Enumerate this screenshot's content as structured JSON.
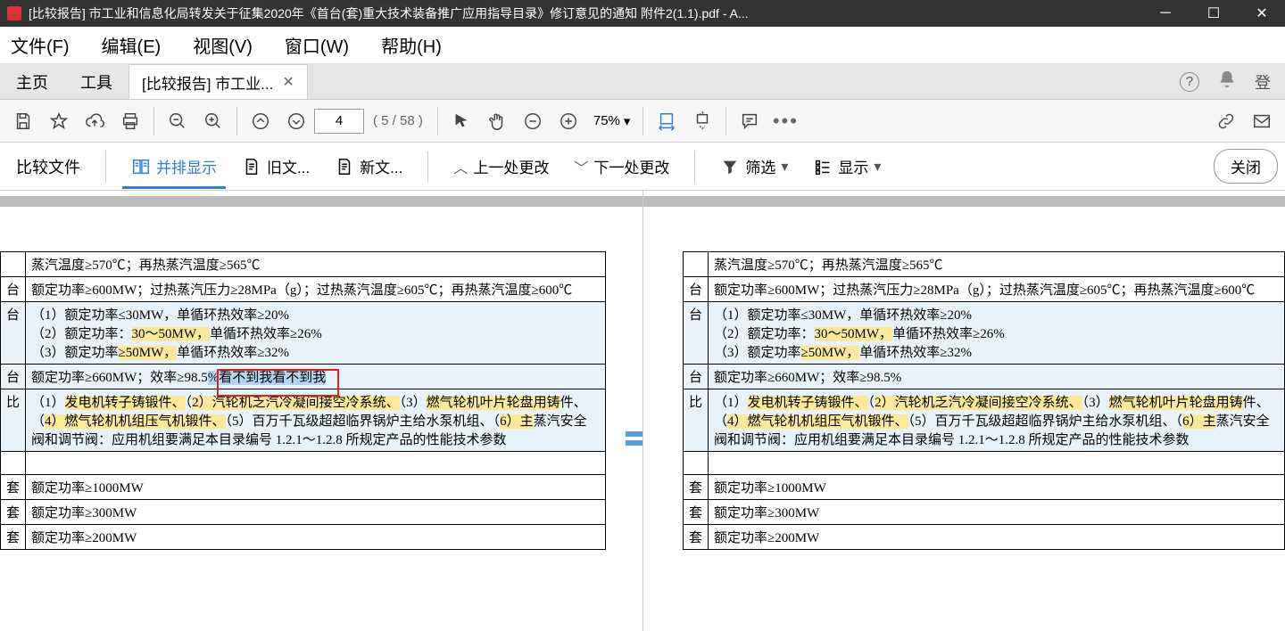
{
  "titlebar": {
    "title": "[比较报告] 市工业和信息化局转发关于征集2020年《首台(套)重大技术装备推广应用指导目录》修订意见的通知 附件2(1.1).pdf - A..."
  },
  "menu": {
    "file": "文件(F)",
    "edit": "编辑(E)",
    "view": "视图(V)",
    "window": "窗口(W)",
    "help": "帮助(H)"
  },
  "tabs": {
    "home": "主页",
    "tools": "工具",
    "active": "[比较报告] 市工业...",
    "login": "登"
  },
  "toolbar": {
    "page_input": "4",
    "page_count": "( 5 / 58 )",
    "zoom": "75%"
  },
  "comparebar": {
    "compare_files": "比较文件",
    "side_by_side": "并排显示",
    "old_doc": "旧文...",
    "new_doc": "新文...",
    "prev_change": "上一处更改",
    "next_change": "下一处更改",
    "filter": "筛选",
    "display": "显示",
    "close": "关闭"
  },
  "doc_left": {
    "rows": [
      {
        "a": "",
        "b": "蒸汽温度≥570℃；再热蒸汽温度≥565℃",
        "cls": ""
      },
      {
        "a": "台",
        "b": "额定功率≥600MW；过热蒸汽压力≥28MPa（g）；过热蒸汽温度≥605℃；再热蒸汽温度≥600℃",
        "cls": ""
      },
      {
        "a": "台",
        "b_html": "（1）额定功率≤30MW，单循环热效率≥20%<br>（2）额定功率：<span class='hl-yellow'>30～50MW，</span>单循环热效率≥26%<br>（3）额定功率<span class='hl-yellow'>≥50MW，</span>单循环热效率≥32%",
        "cls": "row-highlight"
      },
      {
        "a": "台",
        "b_html": "额定功率≥660MW；效率≥98.5<span class='hl-blue'>%看不到我看不到我</span>",
        "cls": "row-highlight",
        "redbox": true
      },
      {
        "a": "比",
        "b_html": "（1）<span class='hl-yellow'>发电机转子铸锻件、</span>（<span class='hl-yellow'>2）汽轮机乏汽冷凝间接空冷系统、</span>（3）<span class='hl-yellow'>燃气轮机叶片轮盘用铸</span>件、（<span class='hl-yellow'>4）燃气轮机机组压气机锻件、</span>（5）百万千瓦级超超临界锅炉主给水泵机组、（<span class='hl-yellow'>6）主</span>蒸汽安全阀和调节阀：应用机组要满足本目录编号 1.2.1～1.2.8 所规定产品的性能技术参数",
        "cls": "row-highlight"
      },
      {
        "a": "",
        "b": "",
        "cls": "nob"
      },
      {
        "a": "套",
        "b": "额定功率≥1000MW",
        "cls": ""
      },
      {
        "a": "套",
        "b": "额定功率≥300MW",
        "cls": ""
      },
      {
        "a": "套",
        "b": "额定功率≥200MW",
        "cls": ""
      }
    ]
  },
  "doc_right": {
    "rows": [
      {
        "a": "",
        "b": "蒸汽温度≥570℃；再热蒸汽温度≥565℃",
        "cls": ""
      },
      {
        "a": "台",
        "b": "额定功率≥600MW；过热蒸汽压力≥28MPa（g）；过热蒸汽温度≥605℃；再热蒸汽温度≥600℃",
        "cls": ""
      },
      {
        "a": "台",
        "b_html": "（1）额定功率≤30MW，单循环热效率≥20%<br>（2）额定功率：<span class='hl-yellow'>30～50MW，</span>单循环热效率≥26%<br>（3）额定功率<span class='hl-yellow'>≥50MW，</span>单循环热效率≥32%",
        "cls": "row-highlight"
      },
      {
        "a": "台",
        "b_html": "额定功率≥660MW；效率≥98.5%",
        "cls": "row-highlight"
      },
      {
        "a": "比",
        "b_html": "（1）<span class='hl-yellow'>发电机转子铸锻件、</span>（<span class='hl-yellow'>2）汽轮机乏汽冷凝间接空冷系统、</span>（3）<span class='hl-yellow'>燃气轮机叶片轮盘用铸</span>件、（<span class='hl-yellow'>4）燃气轮机机组压气机锻件、</span>（5）百万千瓦级超超临界锅炉主给水泵机组、（<span class='hl-yellow'>6）主</span>蒸汽安全阀和调节阀：应用机组要满足本目录编号 1.2.1～1.2.8 所规定产品的性能技术参数",
        "cls": "row-highlight"
      },
      {
        "a": "",
        "b": "",
        "cls": "nob"
      },
      {
        "a": "套",
        "b": "额定功率≥1000MW",
        "cls": ""
      },
      {
        "a": "套",
        "b": "额定功率≥300MW",
        "cls": ""
      },
      {
        "a": "套",
        "b": "额定功率≥200MW",
        "cls": ""
      }
    ]
  }
}
